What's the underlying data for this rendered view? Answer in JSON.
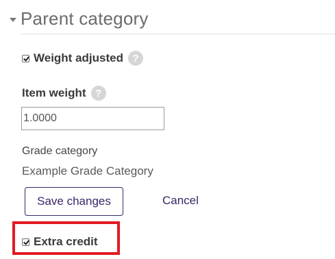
{
  "section": {
    "title": "Parent category"
  },
  "weight_adjusted": {
    "label": "Weight adjusted",
    "checked": true,
    "help": "?"
  },
  "item_weight": {
    "label": "Item weight",
    "help": "?",
    "value": "1.0000"
  },
  "grade_category": {
    "label": "Grade category",
    "value": "Example Grade Category"
  },
  "actions": {
    "save_label": "Save changes",
    "cancel_label": "Cancel"
  },
  "extra_credit": {
    "label": "Extra credit",
    "checked": true
  },
  "colors": {
    "accent": "#3a2569",
    "highlight": "#e11b22"
  }
}
